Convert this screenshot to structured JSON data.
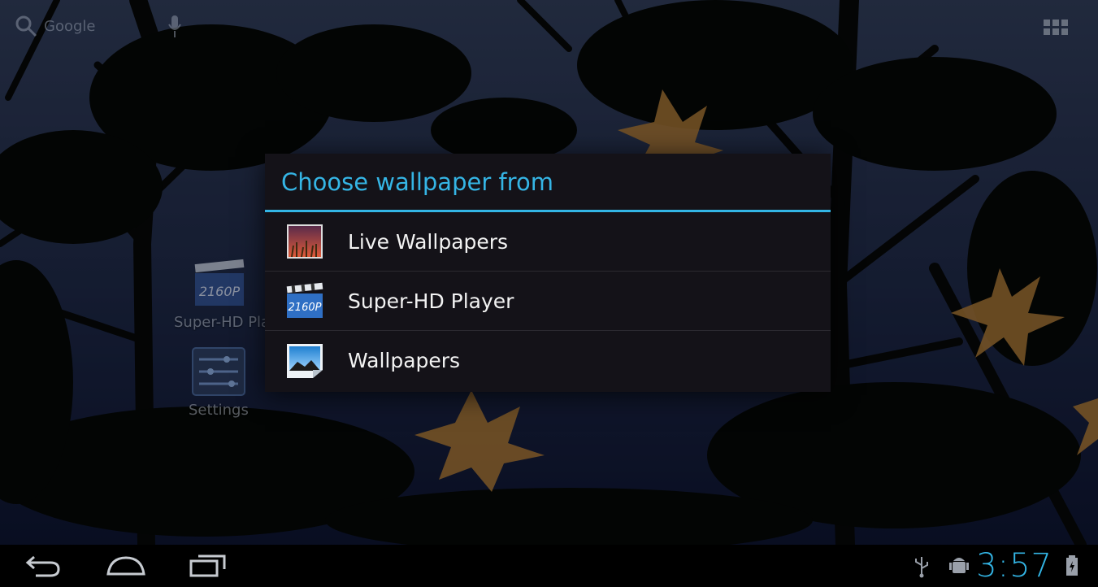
{
  "homescreen": {
    "search_label": "Google",
    "shortcuts": [
      {
        "label": "Super-HD Player",
        "icon": "clapperboard-2160p-icon"
      },
      {
        "label": "Settings",
        "icon": "settings-sliders-icon"
      }
    ]
  },
  "dialog": {
    "title": "Choose wallpaper from",
    "options": [
      {
        "label": "Live Wallpapers",
        "icon": "live-wallpapers-icon"
      },
      {
        "label": "Super-HD Player",
        "icon": "clapperboard-2160p-icon"
      },
      {
        "label": "Wallpapers",
        "icon": "wallpapers-icon"
      }
    ]
  },
  "status_bar": {
    "time": "3:57"
  },
  "colors": {
    "accent": "#33b5e5",
    "dialog_bg": "#141218",
    "navbar_bg": "#000000"
  }
}
